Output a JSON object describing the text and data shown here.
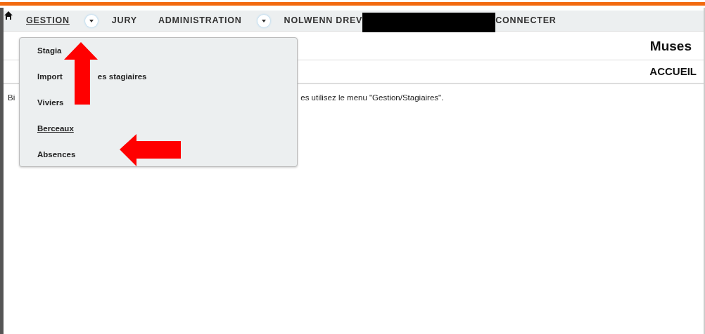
{
  "nav": {
    "items": [
      {
        "label": "GESTION",
        "hovered": true,
        "dropdown": true
      },
      {
        "label": "JURY",
        "hovered": false,
        "dropdown": false
      },
      {
        "label": "ADMINISTRATION",
        "hovered": false,
        "dropdown": true
      },
      {
        "label": "NOLWENN DREV",
        "hovered": false,
        "dropdown": false
      },
      {
        "kind": "redaction"
      },
      {
        "label": "CONNECTER",
        "hovered": false,
        "dropdown": false
      }
    ]
  },
  "header": {
    "title": "Muses",
    "breadcrumb": "ACCUEIL"
  },
  "body": {
    "text_start": "Bi",
    "text_end": "es utilisez le menu \"Gestion/Stagiaires\"."
  },
  "menu": {
    "items": [
      {
        "label": "Stagia",
        "hovered": false
      },
      {
        "label": "Import",
        "label_tail": "es stagiaires",
        "hovered": false
      },
      {
        "label": "Viviers",
        "hovered": false
      },
      {
        "label": "Berceaux",
        "hovered": true
      },
      {
        "label": "Absences",
        "hovered": false
      }
    ]
  }
}
